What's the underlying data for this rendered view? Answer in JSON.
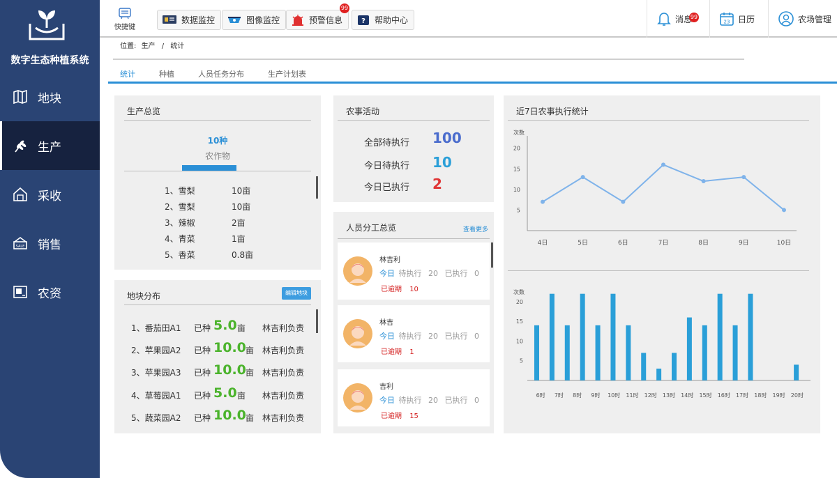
{
  "app": {
    "title": "数字生态种植系统"
  },
  "nav": {
    "items": [
      {
        "label": "地块",
        "icon": "map-icon"
      },
      {
        "label": "生产",
        "icon": "wheat-icon"
      },
      {
        "label": "采收",
        "icon": "harvest-icon"
      },
      {
        "label": "销售",
        "icon": "sale-icon"
      },
      {
        "label": "农资",
        "icon": "supplies-icon"
      }
    ],
    "active_index": 1
  },
  "topbar": {
    "shortcut_label": "快捷键",
    "buttons": [
      {
        "label": "数据监控",
        "icon": "monitor-icon"
      },
      {
        "label": "图像监控",
        "icon": "camera-icon"
      },
      {
        "label": "预警信息",
        "icon": "alarm-icon",
        "badge": "99"
      },
      {
        "label": "帮助中心",
        "icon": "help-icon"
      }
    ],
    "message_label": "消息",
    "message_badge": "99",
    "calendar_label": "日历",
    "calendar_day": "23",
    "user_label": "农场管理"
  },
  "breadcrumb": {
    "prefix": "位置:",
    "items": [
      "生产",
      "统计"
    ],
    "separator": "/"
  },
  "tabs": [
    {
      "label": "统计",
      "active": true
    },
    {
      "label": "种植",
      "active": false
    },
    {
      "label": "人员任务分布",
      "active": false
    },
    {
      "label": "生产计划表",
      "active": false
    }
  ],
  "production_overview": {
    "title": "生产总览",
    "count": "10种",
    "count_label": "农作物",
    "crops": [
      {
        "name": "1、雪梨",
        "area": "10亩"
      },
      {
        "name": "2、雪梨",
        "area": "10亩"
      },
      {
        "name": "3、辣椒",
        "area": "2亩"
      },
      {
        "name": "4、青菜",
        "area": "1亩"
      },
      {
        "name": "5、香菜",
        "area": "0.8亩"
      }
    ]
  },
  "farm_activity": {
    "title": "农事活动",
    "rows": [
      {
        "label": "全部待执行",
        "value": "100",
        "color": "#4a6ccd"
      },
      {
        "label": "今日待执行",
        "value": "10",
        "color": "#2a9fd8"
      },
      {
        "label": "今日已执行",
        "value": "2",
        "color": "#e03535"
      }
    ]
  },
  "staff_overview": {
    "title": "人员分工总览",
    "more_label": "查看更多",
    "today_label": "今日",
    "pending_label": "待执行",
    "done_label": "已执行",
    "overdue_label": "已逾期",
    "people": [
      {
        "name": "林吉利",
        "pending": "20",
        "done": "0",
        "overdue": "10"
      },
      {
        "name": "林吉",
        "pending": "20",
        "done": "0",
        "overdue": "1"
      },
      {
        "name": "吉利",
        "pending": "20",
        "done": "0",
        "overdue": "15"
      }
    ]
  },
  "field_distribution": {
    "title": "地块分布",
    "button_label": "编辑地块",
    "planted_label": "已种",
    "unit": "亩",
    "fields": [
      {
        "name": "1、番茄田A1",
        "value": "5.0",
        "owner": "林吉利负责"
      },
      {
        "name": "2、苹果园A2",
        "value": "10.0",
        "owner": "林吉利负责"
      },
      {
        "name": "3、苹果园A3",
        "value": "10.0",
        "owner": "林吉利负责"
      },
      {
        "name": "4、草莓园A1",
        "value": "5.0",
        "owner": "林吉利负责"
      },
      {
        "name": "5、蔬菜园A2",
        "value": "10.0",
        "owner": "林吉利负责"
      }
    ]
  },
  "stats_panel": {
    "title": "近7日农事执行统计"
  },
  "chart_data": [
    {
      "type": "line",
      "ylabel": "次数",
      "categories": [
        "4日",
        "5日",
        "6日",
        "7日",
        "8日",
        "9日",
        "10日"
      ],
      "values": [
        7,
        13,
        7,
        16,
        12,
        13,
        5
      ],
      "yticks": [
        5,
        10,
        15,
        20
      ],
      "ylim": [
        0,
        23
      ],
      "color": "#7fb3ea"
    },
    {
      "type": "bar",
      "ylabel": "次数",
      "categories": [
        "6时",
        "7时",
        "8时",
        "9时",
        "10时",
        "11时",
        "12时",
        "13时",
        "14时",
        "15时",
        "16时",
        "17时",
        "18时",
        "19时",
        "20时"
      ],
      "values": [
        14,
        22,
        14,
        22,
        14,
        22,
        14,
        7,
        3,
        7,
        16,
        14,
        22,
        14,
        22,
        0,
        0,
        4
      ],
      "bars": [
        {
          "x": "6时",
          "v": 14
        },
        {
          "x": "6时+",
          "v": 22
        },
        {
          "x": "7时+",
          "v": 14
        },
        {
          "x": "8时+",
          "v": 22
        },
        {
          "x": "9时+",
          "v": 14
        },
        {
          "x": "10时+",
          "v": 22
        },
        {
          "x": "11时+",
          "v": 14
        },
        {
          "x": "12时",
          "v": 7
        },
        {
          "x": "13时",
          "v": 3
        },
        {
          "x": "13时+",
          "v": 7
        },
        {
          "x": "14时",
          "v": 16
        },
        {
          "x": "15时",
          "v": 14
        },
        {
          "x": "16时",
          "v": 22
        },
        {
          "x": "16时+",
          "v": 14
        },
        {
          "x": "17时",
          "v": 22
        },
        {
          "x": "20时",
          "v": 4
        }
      ],
      "yticks": [
        5,
        10,
        15,
        20
      ],
      "ylim": [
        0,
        23
      ],
      "color": "#2a9fd8"
    }
  ]
}
